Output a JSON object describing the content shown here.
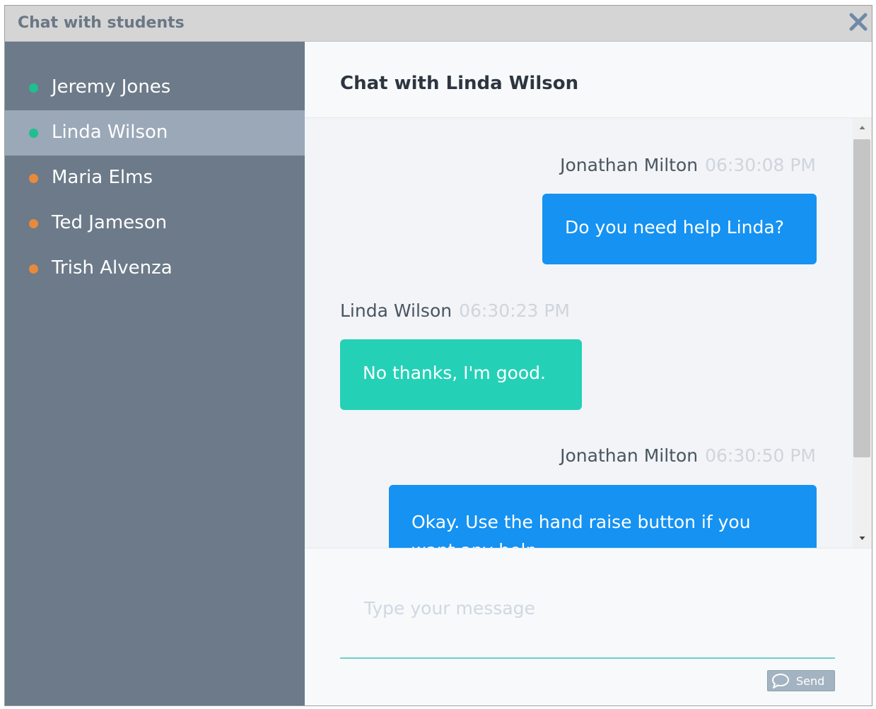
{
  "window": {
    "title": "Chat with students"
  },
  "students": [
    {
      "name": "Jeremy Jones",
      "status": "online",
      "active": false
    },
    {
      "name": "Linda Wilson",
      "status": "online",
      "active": true
    },
    {
      "name": "Maria Elms",
      "status": "away",
      "active": false
    },
    {
      "name": "Ted Jameson",
      "status": "away",
      "active": false
    },
    {
      "name": "Trish Alvenza",
      "status": "away",
      "active": false
    }
  ],
  "chat": {
    "title": "Chat with Linda Wilson",
    "messages": [
      {
        "sender": "Jonathan Milton",
        "time": "06:30:08 PM",
        "text": "Do you need help Linda?"
      },
      {
        "sender": "Linda Wilson",
        "time": "06:30:23 PM",
        "text": "No thanks, I'm good."
      },
      {
        "sender": "Jonathan Milton",
        "time": "06:30:50 PM",
        "text": "Okay. Use the hand raise button if you want any help"
      }
    ]
  },
  "composer": {
    "placeholder": "Type your message",
    "send_label": "Send"
  },
  "colors": {
    "online": "#1fbf8f",
    "away": "#e88a3c",
    "tutor_bubble": "#1592f2",
    "student_bubble": "#24d1b6"
  },
  "icons": {
    "close": "close-icon",
    "send": "chat-bubble-icon"
  }
}
